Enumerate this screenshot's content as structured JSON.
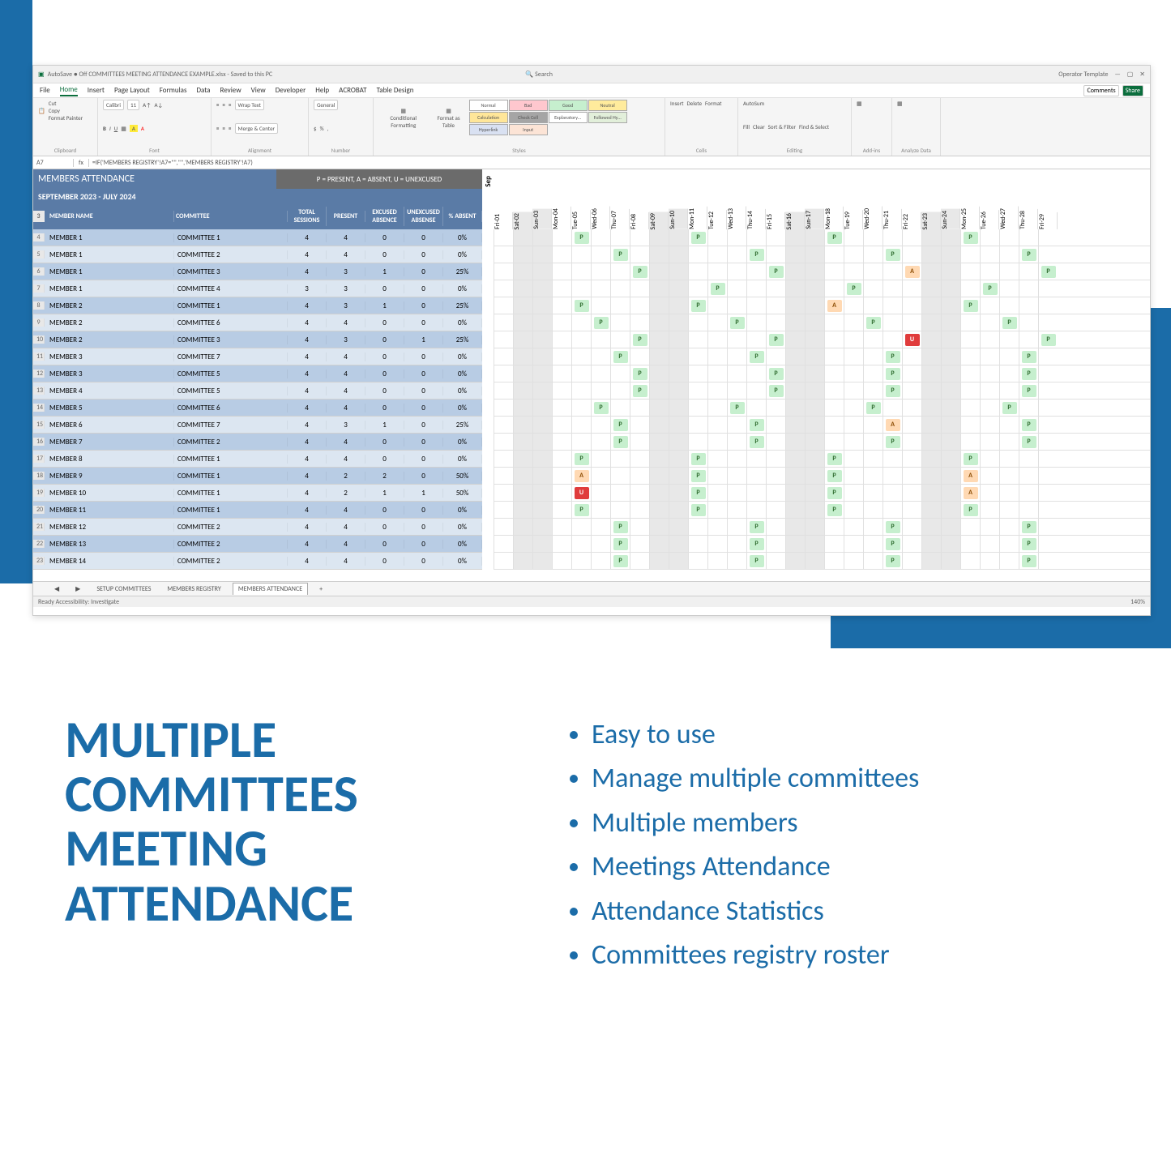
{
  "promo": {
    "title_l1": "MULTIPLE",
    "title_l2": "COMMITTEES",
    "title_l3": "MEETING",
    "title_l4": "ATTENDANCE",
    "bullets": [
      "Easy to use",
      "Manage multiple committees",
      "Multiple members",
      "Meetings Attendance",
      "Attendance Statistics",
      "Committees registry roster"
    ]
  },
  "excel": {
    "titlebar_left": "AutoSave ● Off   COMMITTEES MEETING ATTENDANCE EXAMPLE.xlsx - Saved to this PC",
    "titlebar_search": "Search",
    "titlebar_right": "Operator Template",
    "menu": [
      "File",
      "Home",
      "Insert",
      "Page Layout",
      "Formulas",
      "Data",
      "Review",
      "View",
      "Developer",
      "Help",
      "ACROBAT",
      "Table Design"
    ],
    "menu_active": "Home",
    "comments": "Comments",
    "share": "Share",
    "ribbon": {
      "clipboard": {
        "cut": "Cut",
        "copy": "Copy",
        "painter": "Format Painter",
        "lbl": "Clipboard"
      },
      "font": {
        "name": "Calibri",
        "size": "11",
        "lbl": "Font"
      },
      "align": {
        "wrap": "Wrap Text",
        "merge": "Merge & Center",
        "lbl": "Alignment"
      },
      "number": {
        "fmt": "General",
        "lbl": "Number"
      },
      "styles": {
        "cf": "Conditional Formatting",
        "fat": "Format as Table",
        "cells": [
          "Normal",
          "Bad",
          "Good",
          "Neutral",
          "Calculation",
          "Check Cell",
          "Explanatory…",
          "Followed Hy…",
          "Hyperlink",
          "Input"
        ],
        "lbl": "Styles"
      },
      "cells_grp": {
        "ins": "Insert",
        "del": "Delete",
        "fmt": "Format",
        "lbl": "Cells"
      },
      "editing": {
        "sum": "AutoSum",
        "fill": "Fill",
        "clear": "Clear",
        "sort": "Sort & Filter",
        "find": "Find & Select",
        "lbl": "Editing"
      },
      "addins": {
        "lbl": "Add-ins"
      },
      "analyze": {
        "lbl": "Analyze Data"
      }
    },
    "namebox": "A7",
    "formula": "=IF('MEMBERS REGISTRY'!A7=\"\",\"\",'MEMBERS REGISTRY'!A7)",
    "header": {
      "title": "MEMBERS ATTENDANCE",
      "subtitle": "SEPTEMBER 2023 - JULY 2024",
      "legend": "P = PRESENT,   A = ABSENT,   U = UNEXCUSED",
      "cols": {
        "name": "MEMBER NAME",
        "comm": "COMMITTEE",
        "total": "TOTAL SESSIONS",
        "present": "PRESENT",
        "exc": "EXCUSED ABSENCE",
        "unexc": "UNEXCUSED ABSENSE",
        "pct": "% ABSENT"
      }
    },
    "month": "Sep",
    "dates": [
      "Fri-01",
      "Sat-02",
      "Sun-03",
      "Mon-04",
      "Tue-05",
      "Wed-06",
      "Thu-07",
      "Fri-08",
      "Sat-09",
      "Sun-10",
      "Mon-11",
      "Tue-12",
      "Wed-13",
      "Thu-14",
      "Fri-15",
      "Sat-16",
      "Sun-17",
      "Mon-18",
      "Tue-19",
      "Wed-20",
      "Thu-21",
      "Fri-22",
      "Sat-23",
      "Sun-24",
      "Mon-25",
      "Tue-26",
      "Wed-27",
      "Thu-28",
      "Fri-29"
    ],
    "weekends": [
      1,
      2,
      8,
      9,
      15,
      16,
      22,
      23
    ],
    "rows": [
      {
        "n": 4,
        "name": "MEMBER 1",
        "comm": "COMMITTEE 1",
        "t": 4,
        "p": 4,
        "e": 0,
        "u": 0,
        "pct": "0%",
        "marks": {
          "4": "P",
          "10": "P",
          "17": "P",
          "24": "P"
        }
      },
      {
        "n": 5,
        "name": "MEMBER 1",
        "comm": "COMMITTEE 2",
        "t": 4,
        "p": 4,
        "e": 0,
        "u": 0,
        "pct": "0%",
        "marks": {
          "6": "P",
          "13": "P",
          "20": "P",
          "27": "P"
        }
      },
      {
        "n": 6,
        "name": "MEMBER 1",
        "comm": "COMMITTEE 3",
        "t": 4,
        "p": 3,
        "e": 1,
        "u": 0,
        "pct": "25%",
        "marks": {
          "7": "P",
          "14": "P",
          "21": "A",
          "28": "P"
        }
      },
      {
        "n": 7,
        "name": "MEMBER 1",
        "comm": "COMMITTEE 4",
        "t": 3,
        "p": 3,
        "e": 0,
        "u": 0,
        "pct": "0%",
        "marks": {
          "11": "P",
          "18": "P",
          "25": "P"
        }
      },
      {
        "n": 8,
        "name": "MEMBER 2",
        "comm": "COMMITTEE 1",
        "t": 4,
        "p": 3,
        "e": 1,
        "u": 0,
        "pct": "25%",
        "marks": {
          "4": "P",
          "10": "P",
          "17": "A",
          "24": "P"
        }
      },
      {
        "n": 9,
        "name": "MEMBER 2",
        "comm": "COMMITTEE 6",
        "t": 4,
        "p": 4,
        "e": 0,
        "u": 0,
        "pct": "0%",
        "marks": {
          "5": "P",
          "12": "P",
          "19": "P",
          "26": "P"
        }
      },
      {
        "n": 10,
        "name": "MEMBER 2",
        "comm": "COMMITTEE 3",
        "t": 4,
        "p": 3,
        "e": 0,
        "u": 1,
        "pct": "25%",
        "marks": {
          "7": "P",
          "14": "P",
          "21": "U",
          "28": "P"
        }
      },
      {
        "n": 11,
        "name": "MEMBER 3",
        "comm": "COMMITTEE 7",
        "t": 4,
        "p": 4,
        "e": 0,
        "u": 0,
        "pct": "0%",
        "marks": {
          "6": "P",
          "13": "P",
          "20": "P",
          "27": "P"
        }
      },
      {
        "n": 12,
        "name": "MEMBER 3",
        "comm": "COMMITTEE 5",
        "t": 4,
        "p": 4,
        "e": 0,
        "u": 0,
        "pct": "0%",
        "marks": {
          "7": "P",
          "14": "P",
          "20": "P",
          "27": "P"
        }
      },
      {
        "n": 13,
        "name": "MEMBER 4",
        "comm": "COMMITTEE 5",
        "t": 4,
        "p": 4,
        "e": 0,
        "u": 0,
        "pct": "0%",
        "marks": {
          "7": "P",
          "14": "P",
          "20": "P",
          "27": "P"
        }
      },
      {
        "n": 14,
        "name": "MEMBER 5",
        "comm": "COMMITTEE 6",
        "t": 4,
        "p": 4,
        "e": 0,
        "u": 0,
        "pct": "0%",
        "marks": {
          "5": "P",
          "12": "P",
          "19": "P",
          "26": "P"
        }
      },
      {
        "n": 15,
        "name": "MEMBER 6",
        "comm": "COMMITTEE 7",
        "t": 4,
        "p": 3,
        "e": 1,
        "u": 0,
        "pct": "25%",
        "marks": {
          "6": "P",
          "13": "P",
          "20": "A",
          "27": "P"
        }
      },
      {
        "n": 16,
        "name": "MEMBER 7",
        "comm": "COMMITTEE 2",
        "t": 4,
        "p": 4,
        "e": 0,
        "u": 0,
        "pct": "0%",
        "marks": {
          "6": "P",
          "13": "P",
          "20": "P",
          "27": "P"
        }
      },
      {
        "n": 17,
        "name": "MEMBER 8",
        "comm": "COMMITTEE 1",
        "t": 4,
        "p": 4,
        "e": 0,
        "u": 0,
        "pct": "0%",
        "marks": {
          "4": "P",
          "10": "P",
          "17": "P",
          "24": "P"
        }
      },
      {
        "n": 18,
        "name": "MEMBER 9",
        "comm": "COMMITTEE 1",
        "t": 4,
        "p": 2,
        "e": 2,
        "u": 0,
        "pct": "50%",
        "marks": {
          "4": "A",
          "10": "P",
          "17": "P",
          "24": "A"
        }
      },
      {
        "n": 19,
        "name": "MEMBER 10",
        "comm": "COMMITTEE 1",
        "t": 4,
        "p": 2,
        "e": 1,
        "u": 1,
        "pct": "50%",
        "marks": {
          "4": "U",
          "10": "P",
          "17": "P",
          "24": "A"
        }
      },
      {
        "n": 20,
        "name": "MEMBER 11",
        "comm": "COMMITTEE 1",
        "t": 4,
        "p": 4,
        "e": 0,
        "u": 0,
        "pct": "0%",
        "marks": {
          "4": "P",
          "10": "P",
          "17": "P",
          "24": "P"
        }
      },
      {
        "n": 21,
        "name": "MEMBER 12",
        "comm": "COMMITTEE 2",
        "t": 4,
        "p": 4,
        "e": 0,
        "u": 0,
        "pct": "0%",
        "marks": {
          "6": "P",
          "13": "P",
          "20": "P",
          "27": "P"
        }
      },
      {
        "n": 22,
        "name": "MEMBER 13",
        "comm": "COMMITTEE 2",
        "t": 4,
        "p": 4,
        "e": 0,
        "u": 0,
        "pct": "0%",
        "marks": {
          "6": "P",
          "13": "P",
          "20": "P",
          "27": "P"
        }
      },
      {
        "n": 23,
        "name": "MEMBER 14",
        "comm": "COMMITTEE 2",
        "t": 4,
        "p": 4,
        "e": 0,
        "u": 0,
        "pct": "0%",
        "marks": {
          "6": "P",
          "13": "P",
          "20": "P",
          "27": "P"
        }
      }
    ],
    "tabs": [
      "SETUP COMMITTEES",
      "MEMBERS REGISTRY",
      "MEMBERS ATTENDANCE"
    ],
    "tab_active": "MEMBERS ATTENDANCE",
    "status": "Ready   Accessibility: Investigate",
    "zoom": "140%"
  }
}
